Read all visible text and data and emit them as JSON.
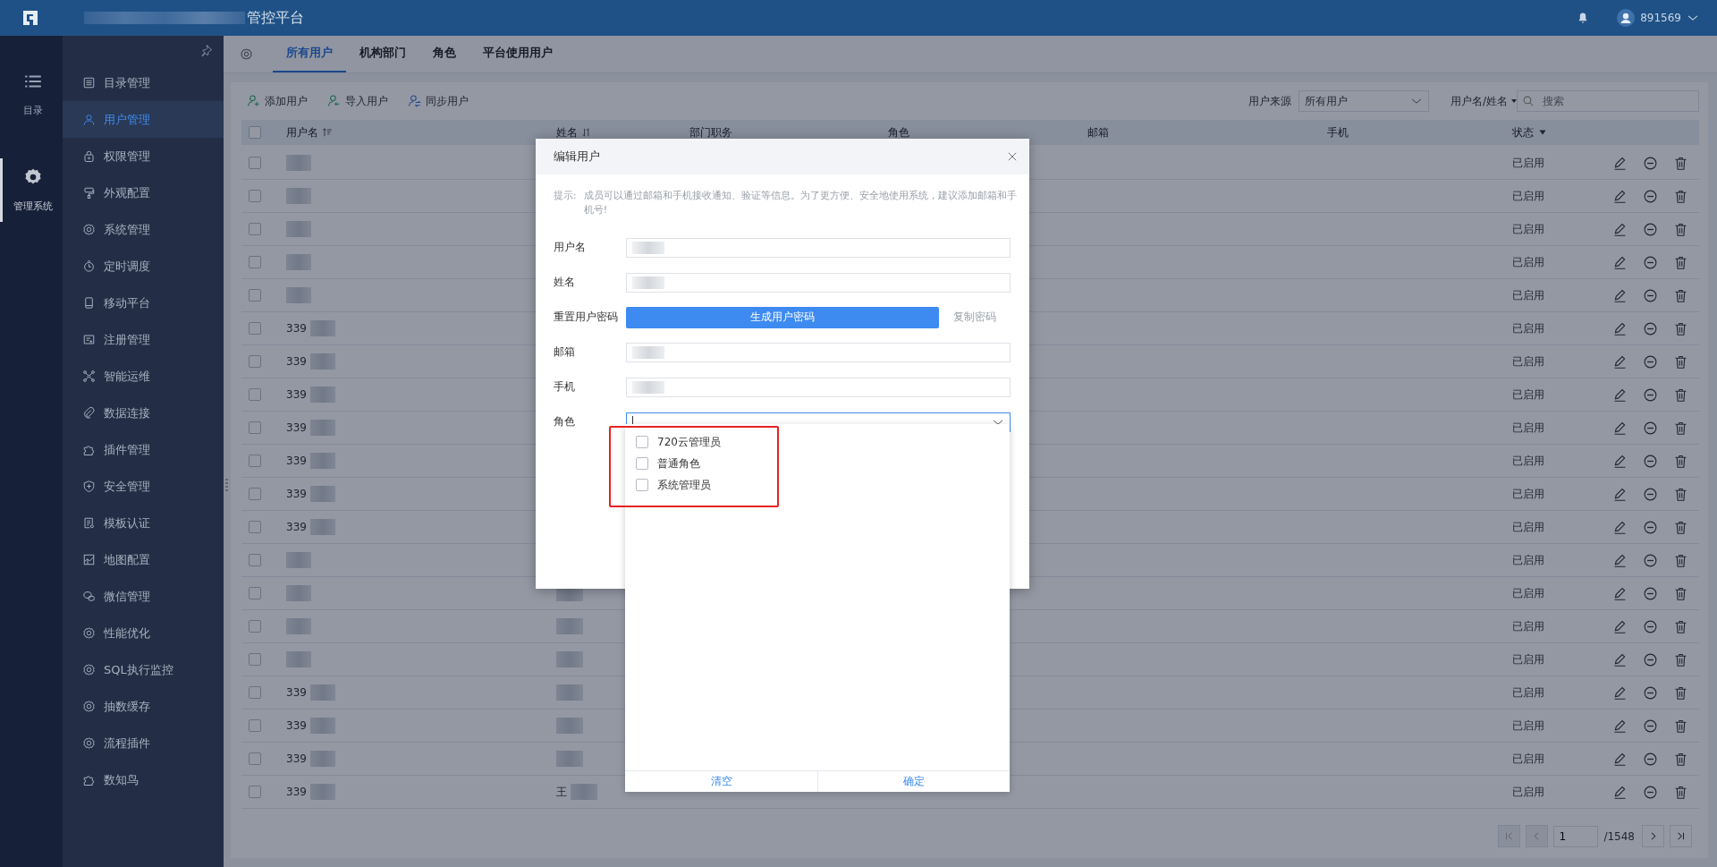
{
  "app": {
    "title": "管控平台"
  },
  "user": {
    "name": "891569"
  },
  "rail": [
    {
      "label": "目录",
      "selected": false
    },
    {
      "label": "管理系统",
      "selected": true
    }
  ],
  "sidebar": {
    "items": [
      {
        "label": "目录管理",
        "selected": false
      },
      {
        "label": "用户管理",
        "selected": true
      },
      {
        "label": "权限管理",
        "selected": false
      },
      {
        "label": "外观配置",
        "selected": false
      },
      {
        "label": "系统管理",
        "selected": false
      },
      {
        "label": "定时调度",
        "selected": false
      },
      {
        "label": "移动平台",
        "selected": false
      },
      {
        "label": "注册管理",
        "selected": false
      },
      {
        "label": "智能运维",
        "selected": false
      },
      {
        "label": "数据连接",
        "selected": false
      },
      {
        "label": "插件管理",
        "selected": false
      },
      {
        "label": "安全管理",
        "selected": false
      },
      {
        "label": "模板认证",
        "selected": false
      },
      {
        "label": "地图配置",
        "selected": false
      },
      {
        "label": "微信管理",
        "selected": false
      },
      {
        "label": "性能优化",
        "selected": false
      },
      {
        "label": "SQL执行监控",
        "selected": false
      },
      {
        "label": "抽数缓存",
        "selected": false
      },
      {
        "label": "流程插件",
        "selected": false
      },
      {
        "label": "数知鸟",
        "selected": false
      }
    ]
  },
  "tabs": [
    {
      "label": "所有用户",
      "selected": true
    },
    {
      "label": "机构部门",
      "selected": false
    },
    {
      "label": "角色",
      "selected": false
    },
    {
      "label": "平台使用用户",
      "selected": false
    }
  ],
  "toolbar": {
    "actions": [
      "添加用户",
      "导入用户",
      "同步用户"
    ],
    "source_label": "用户来源",
    "source_value": "所有用户",
    "search_scope": "用户名/姓名",
    "search_placeholder": "搜索"
  },
  "table": {
    "all_checked": false,
    "columns": [
      "用户名",
      "姓名",
      "部门职务",
      "角色",
      "邮箱",
      "手机",
      "状态"
    ],
    "rows": [
      {
        "checked": false,
        "status": "已启用"
      },
      {
        "checked": false,
        "status": "已启用"
      },
      {
        "checked": false,
        "status": "已启用"
      },
      {
        "checked": false,
        "status": "已启用"
      },
      {
        "checked": false,
        "status": "已启用"
      },
      {
        "checked": false,
        "username": "339",
        "status": "已启用"
      },
      {
        "checked": false,
        "username": "339",
        "status": "已启用"
      },
      {
        "checked": false,
        "username": "339",
        "status": "已启用"
      },
      {
        "checked": false,
        "username": "339",
        "status": "已启用"
      },
      {
        "checked": false,
        "username": "339",
        "status": "已启用"
      },
      {
        "checked": false,
        "username": "339",
        "status": "已启用"
      },
      {
        "checked": false,
        "username": "339",
        "status": "已启用"
      },
      {
        "checked": false,
        "status": "已启用"
      },
      {
        "checked": false,
        "status": "已启用"
      },
      {
        "checked": false,
        "status": "已启用"
      },
      {
        "checked": false,
        "status": "已启用"
      },
      {
        "checked": false,
        "username": "339",
        "status": "已启用"
      },
      {
        "checked": false,
        "username": "339",
        "status": "已启用"
      },
      {
        "checked": false,
        "username": "339",
        "status": "已启用"
      },
      {
        "checked": false,
        "username": "339",
        "name": "王",
        "status": "已启用"
      }
    ]
  },
  "pagination": {
    "page": "1",
    "total": "/1548"
  },
  "dialog": {
    "title": "编辑用户",
    "hint_label": "提示:",
    "hint": "成员可以通过邮箱和手机接收通知、验证等信息。为了更方便、安全地使用系统，建议添加邮箱和手机号!",
    "fields": [
      {
        "label": "用户名",
        "kind": "input"
      },
      {
        "label": "姓名",
        "kind": "input"
      },
      {
        "label": "重置用户密码",
        "kind": "password",
        "button": "生成用户密码",
        "link": "复制密码"
      },
      {
        "label": "邮箱",
        "kind": "input"
      },
      {
        "label": "手机",
        "kind": "input"
      },
      {
        "label": "角色",
        "kind": "select"
      }
    ],
    "role_options": [
      {
        "label": "720云管理员",
        "checked": false
      },
      {
        "label": "普通角色",
        "checked": false
      },
      {
        "label": "系统管理员",
        "checked": false
      }
    ],
    "role_footer": [
      "清空",
      "确定"
    ]
  }
}
